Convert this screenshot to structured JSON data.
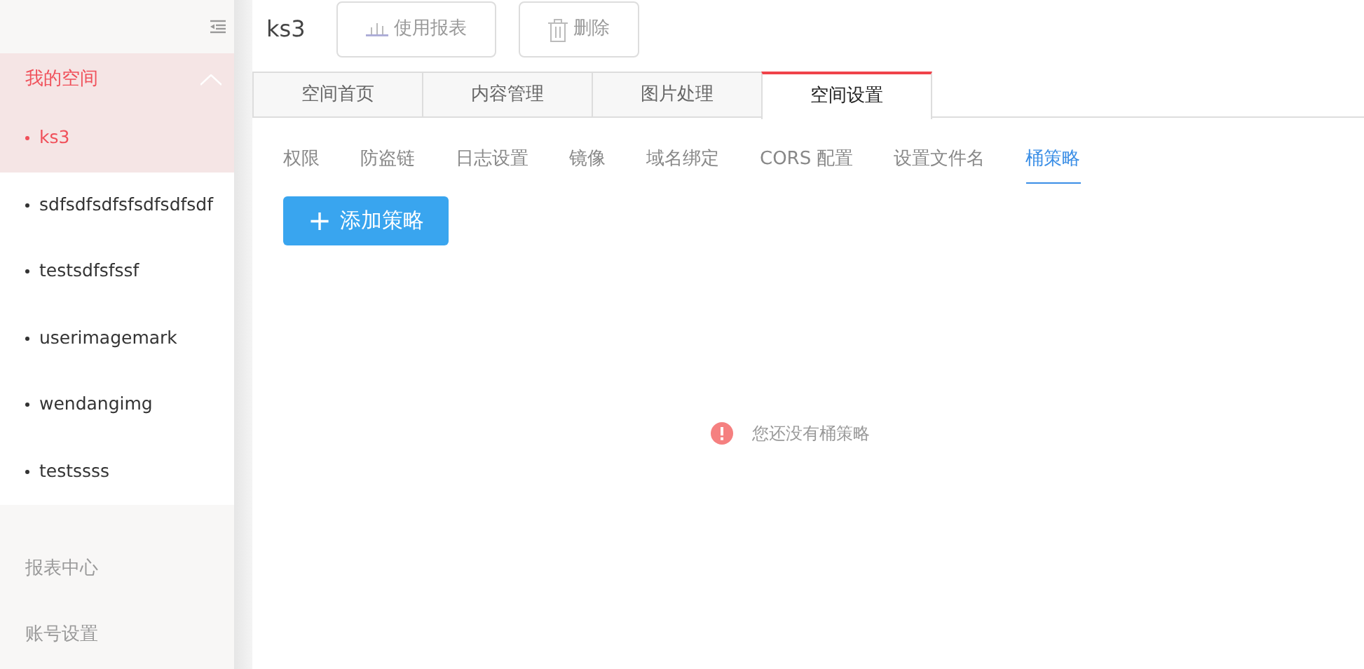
{
  "sidebar": {
    "group": {
      "label": "我的空间",
      "expanded": true,
      "items": [
        {
          "label": "ks3",
          "selected": true
        },
        {
          "label": "sdfsdfsdfsfsdfsdfsdf",
          "selected": false
        },
        {
          "label": "testsdfsfssf",
          "selected": false
        },
        {
          "label": "userimagemark",
          "selected": false
        },
        {
          "label": "wendangimg",
          "selected": false
        },
        {
          "label": "testssss",
          "selected": false
        }
      ]
    },
    "links": [
      "报表中心",
      "账号设置"
    ]
  },
  "header": {
    "title": "ks3",
    "buttons": [
      {
        "label": "使用报表",
        "kind": "report"
      },
      {
        "label": "删除",
        "kind": "delete"
      }
    ]
  },
  "tabs": [
    {
      "label": "空间首页",
      "selected": false
    },
    {
      "label": "内容管理",
      "selected": false
    },
    {
      "label": "图片处理",
      "selected": false
    },
    {
      "label": "空间设置",
      "selected": true
    }
  ],
  "subtabs": [
    {
      "label": "权限",
      "selected": false
    },
    {
      "label": "防盗链",
      "selected": false
    },
    {
      "label": "日志设置",
      "selected": false
    },
    {
      "label": "镜像",
      "selected": false
    },
    {
      "label": "域名绑定",
      "selected": false
    },
    {
      "label": "CORS 配置",
      "selected": false
    },
    {
      "label": "设置文件名",
      "selected": false
    },
    {
      "label": "桶策略",
      "selected": true
    }
  ],
  "add_button": {
    "icon": "+",
    "label": "添加策略"
  },
  "empty_message": "您还没有桶策略"
}
